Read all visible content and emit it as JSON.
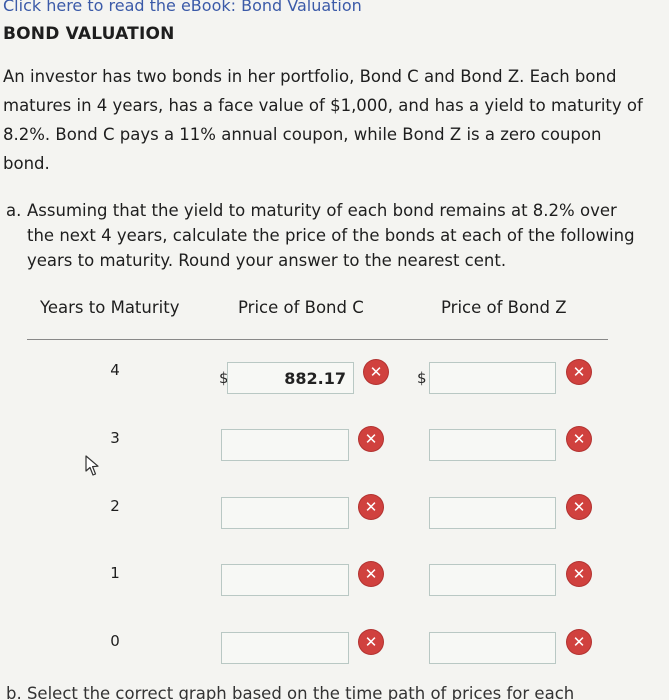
{
  "header": {
    "ebook_link": "Click here to read the eBook: Bond Valuation",
    "title": "BOND VALUATION"
  },
  "problem": {
    "text": "An investor has two bonds in her portfolio, Bond C and Bond Z. Each bond matures in 4 years, has a face value of $1,000, and has a yield to maturity of 8.2%. Bond C pays a 11% annual coupon, while Bond Z is a zero coupon bond."
  },
  "part_a": {
    "label": "a.",
    "text": "Assuming that the yield to maturity of each bond remains at 8.2% over the next 4 years, calculate the price of the bonds at each of the following years to maturity. Round your answer to the nearest cent."
  },
  "table": {
    "headers": {
      "years": "Years to Maturity",
      "bond_c": "Price of Bond C",
      "bond_z": "Price of Bond Z"
    },
    "currency": "$",
    "rows": [
      {
        "years": "4",
        "price_c": "882.17",
        "price_z": ""
      },
      {
        "years": "3",
        "price_c": "",
        "price_z": ""
      },
      {
        "years": "2",
        "price_c": "",
        "price_z": ""
      },
      {
        "years": "1",
        "price_c": "",
        "price_z": ""
      },
      {
        "years": "0",
        "price_c": "",
        "price_z": ""
      }
    ]
  },
  "icons": {
    "incorrect": "x-circle-icon",
    "cursor": "mouse-pointer-icon",
    "incorrect_glyph": "✕"
  },
  "colors": {
    "incorrect": "#d0413e",
    "link": "#3b5aa8"
  },
  "footer": {
    "cut_text": "b. Select the correct graph based on the time path of prices for each"
  }
}
